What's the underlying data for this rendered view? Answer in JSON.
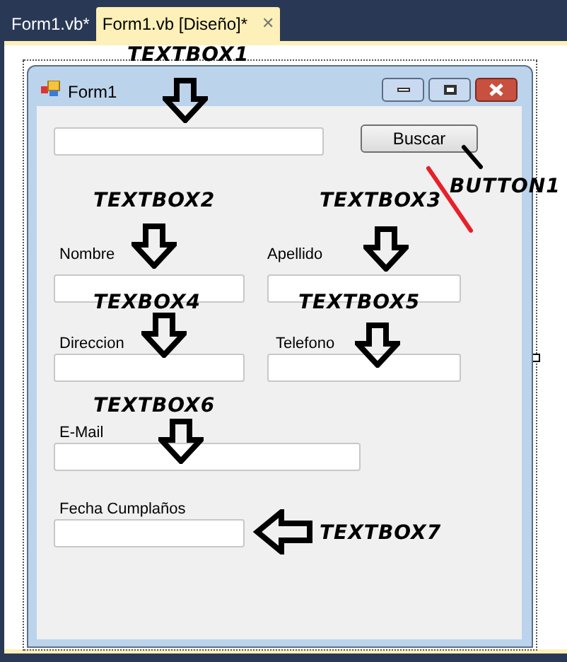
{
  "tabs": [
    {
      "label": "Form1.vb*",
      "selected": false
    },
    {
      "label": "Form1.vb [Diseño]*",
      "selected": true,
      "close": "✕"
    }
  ],
  "form": {
    "title": "Form1",
    "button": "Buscar",
    "labels": [
      "Nombre",
      "Apellido",
      "Direccion",
      "Telefono",
      "E-Mail",
      "Fecha Cumplaños"
    ]
  },
  "annotations": [
    "TEXTBOX1",
    "TEXTBOX2",
    "TEXTBOX3",
    "BUTTON1",
    "TEXBOX4",
    "TEXTBOX5",
    "TEXTBOX6",
    "TEXTBOX7"
  ]
}
